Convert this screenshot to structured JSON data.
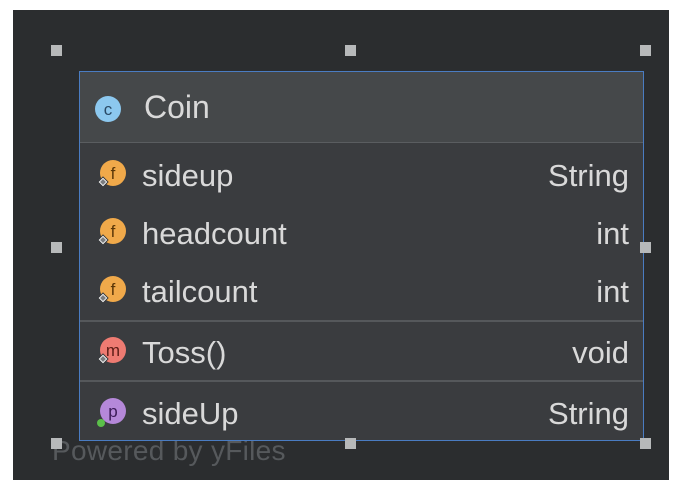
{
  "class": {
    "kind_letter": "c",
    "name": "Coin"
  },
  "fields": [
    {
      "icon_letter": "f",
      "name": "sideup",
      "type": "String"
    },
    {
      "icon_letter": "f",
      "name": "headcount",
      "type": "int"
    },
    {
      "icon_letter": "f",
      "name": "tailcount",
      "type": "int"
    }
  ],
  "methods": [
    {
      "icon_letter": "m",
      "name": "Toss()",
      "type": "void"
    }
  ],
  "properties": [
    {
      "icon_letter": "p",
      "name": "sideUp",
      "type": "String"
    }
  ],
  "watermark": "Powered by yFiles",
  "colors": {
    "canvas": "#2b2d2f",
    "node_border": "#4a7cc2",
    "class_icon": "#8cc8ef",
    "field_icon": "#f0a94a",
    "method_icon": "#ee7b72",
    "property_icon": "#b588d9"
  },
  "icons": {
    "class": "class-icon",
    "field": "field-icon",
    "method": "method-icon",
    "property": "property-icon"
  }
}
